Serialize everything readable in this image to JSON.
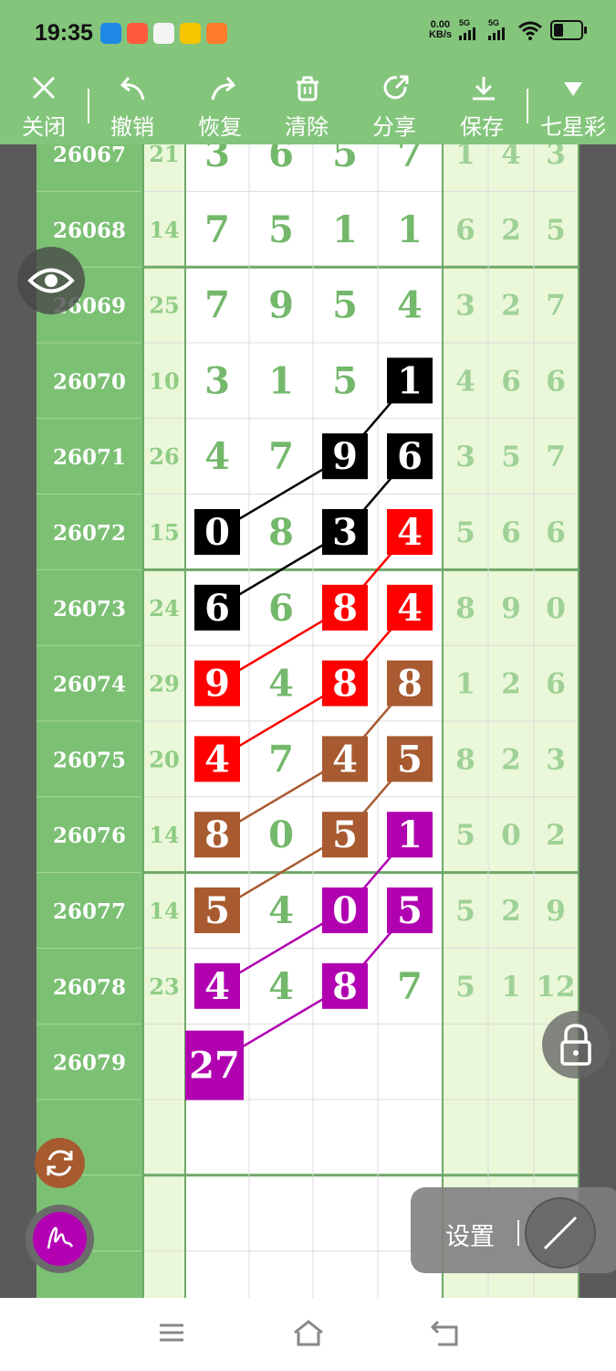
{
  "status_bar": {
    "time": "19:35",
    "net_speed_value": "0.00",
    "net_speed_unit": "KB/s",
    "sim1": "5G",
    "sim2": "5G",
    "app_icon_colors": [
      "#1e88e5",
      "#ff5a3c",
      "#f4f4f4",
      "#f6c500",
      "#ff7b2c"
    ]
  },
  "toolbar": {
    "close_label": "关闭",
    "undo_label": "撤销",
    "redo_label": "恢复",
    "clear_label": "清除",
    "share_label": "分享",
    "save_label": "保存",
    "lottery_label": "七星彩"
  },
  "grid": {
    "rows": [
      {
        "issue": "26067",
        "sum": "21",
        "digits": [
          "3",
          "6",
          "5",
          "7"
        ],
        "tail": [
          "1",
          "4",
          "3"
        ]
      },
      {
        "issue": "26068",
        "sum": "14",
        "digits": [
          "7",
          "5",
          "1",
          "1"
        ],
        "tail": [
          "6",
          "2",
          "5"
        ]
      },
      {
        "issue": "26069",
        "sum": "25",
        "digits": [
          "7",
          "9",
          "5",
          "4"
        ],
        "tail": [
          "3",
          "2",
          "7"
        ]
      },
      {
        "issue": "26070",
        "sum": "10",
        "digits": [
          "3",
          "1",
          "5",
          "1"
        ],
        "tail": [
          "4",
          "6",
          "6"
        ]
      },
      {
        "issue": "26071",
        "sum": "26",
        "digits": [
          "4",
          "7",
          "9",
          "6"
        ],
        "tail": [
          "3",
          "5",
          "7"
        ]
      },
      {
        "issue": "26072",
        "sum": "15",
        "digits": [
          "0",
          "8",
          "3",
          "4"
        ],
        "tail": [
          "5",
          "6",
          "6"
        ]
      },
      {
        "issue": "26073",
        "sum": "24",
        "digits": [
          "6",
          "6",
          "8",
          "4"
        ],
        "tail": [
          "8",
          "9",
          "0"
        ]
      },
      {
        "issue": "26074",
        "sum": "29",
        "digits": [
          "9",
          "4",
          "8",
          "8"
        ],
        "tail": [
          "1",
          "2",
          "6"
        ]
      },
      {
        "issue": "26075",
        "sum": "20",
        "digits": [
          "4",
          "7",
          "4",
          "5"
        ],
        "tail": [
          "8",
          "2",
          "3"
        ]
      },
      {
        "issue": "26076",
        "sum": "14",
        "digits": [
          "8",
          "0",
          "5",
          "1"
        ],
        "tail": [
          "5",
          "0",
          "2"
        ]
      },
      {
        "issue": "26077",
        "sum": "14",
        "digits": [
          "5",
          "4",
          "0",
          "5"
        ],
        "tail": [
          "5",
          "2",
          "9"
        ]
      },
      {
        "issue": "26078",
        "sum": "23",
        "digits": [
          "4",
          "4",
          "8",
          "7"
        ],
        "tail": [
          "5",
          "1",
          "12"
        ]
      },
      {
        "issue": "26079",
        "sum": "",
        "digits": [
          "27",
          "",
          "",
          ""
        ],
        "tail": [
          "",
          "",
          ""
        ]
      }
    ],
    "highlight_colors": {
      "black": "#000000",
      "red": "#ff0000",
      "brown": "#a85a30",
      "purple": "#b000b0"
    },
    "highlights": [
      {
        "row": 3,
        "col": 3,
        "color": "black"
      },
      {
        "row": 4,
        "col": 2,
        "color": "black"
      },
      {
        "row": 4,
        "col": 3,
        "color": "black"
      },
      {
        "row": 5,
        "col": 0,
        "color": "black"
      },
      {
        "row": 5,
        "col": 2,
        "color": "black"
      },
      {
        "row": 5,
        "col": 3,
        "color": "red"
      },
      {
        "row": 6,
        "col": 0,
        "color": "black"
      },
      {
        "row": 6,
        "col": 2,
        "color": "red"
      },
      {
        "row": 6,
        "col": 3,
        "color": "red"
      },
      {
        "row": 7,
        "col": 0,
        "color": "red"
      },
      {
        "row": 7,
        "col": 2,
        "color": "red"
      },
      {
        "row": 7,
        "col": 3,
        "color": "brown"
      },
      {
        "row": 8,
        "col": 0,
        "color": "red"
      },
      {
        "row": 8,
        "col": 2,
        "color": "brown"
      },
      {
        "row": 8,
        "col": 3,
        "color": "brown"
      },
      {
        "row": 9,
        "col": 0,
        "color": "brown"
      },
      {
        "row": 9,
        "col": 2,
        "color": "brown"
      },
      {
        "row": 9,
        "col": 3,
        "color": "purple"
      },
      {
        "row": 10,
        "col": 0,
        "color": "brown"
      },
      {
        "row": 10,
        "col": 2,
        "color": "purple"
      },
      {
        "row": 10,
        "col": 3,
        "color": "purple"
      },
      {
        "row": 11,
        "col": 0,
        "color": "purple"
      },
      {
        "row": 11,
        "col": 2,
        "color": "purple"
      },
      {
        "row": 12,
        "col": 0,
        "color": "purple"
      }
    ],
    "lines": [
      {
        "from": [
          3,
          3
        ],
        "to": [
          4,
          2
        ],
        "color": "black"
      },
      {
        "from": [
          4,
          2
        ],
        "to": [
          5,
          0
        ],
        "color": "black"
      },
      {
        "from": [
          4,
          3
        ],
        "to": [
          5,
          2
        ],
        "color": "black"
      },
      {
        "from": [
          5,
          2
        ],
        "to": [
          6,
          0
        ],
        "color": "black"
      },
      {
        "from": [
          5,
          3
        ],
        "to": [
          6,
          2
        ],
        "color": "red"
      },
      {
        "from": [
          6,
          2
        ],
        "to": [
          7,
          0
        ],
        "color": "red"
      },
      {
        "from": [
          6,
          3
        ],
        "to": [
          7,
          2
        ],
        "color": "red"
      },
      {
        "from": [
          7,
          2
        ],
        "to": [
          8,
          0
        ],
        "color": "red"
      },
      {
        "from": [
          7,
          3
        ],
        "to": [
          8,
          2
        ],
        "color": "brown"
      },
      {
        "from": [
          8,
          2
        ],
        "to": [
          9,
          0
        ],
        "color": "brown"
      },
      {
        "from": [
          8,
          3
        ],
        "to": [
          9,
          2
        ],
        "color": "brown"
      },
      {
        "from": [
          9,
          2
        ],
        "to": [
          10,
          0
        ],
        "color": "brown"
      },
      {
        "from": [
          9,
          3
        ],
        "to": [
          10,
          2
        ],
        "color": "purple"
      },
      {
        "from": [
          10,
          2
        ],
        "to": [
          11,
          0
        ],
        "color": "purple"
      },
      {
        "from": [
          10,
          3
        ],
        "to": [
          11,
          2
        ],
        "color": "purple"
      },
      {
        "from": [
          11,
          2
        ],
        "to": [
          12,
          0
        ],
        "color": "purple"
      }
    ]
  },
  "floating": {
    "settings_label": "设置"
  }
}
